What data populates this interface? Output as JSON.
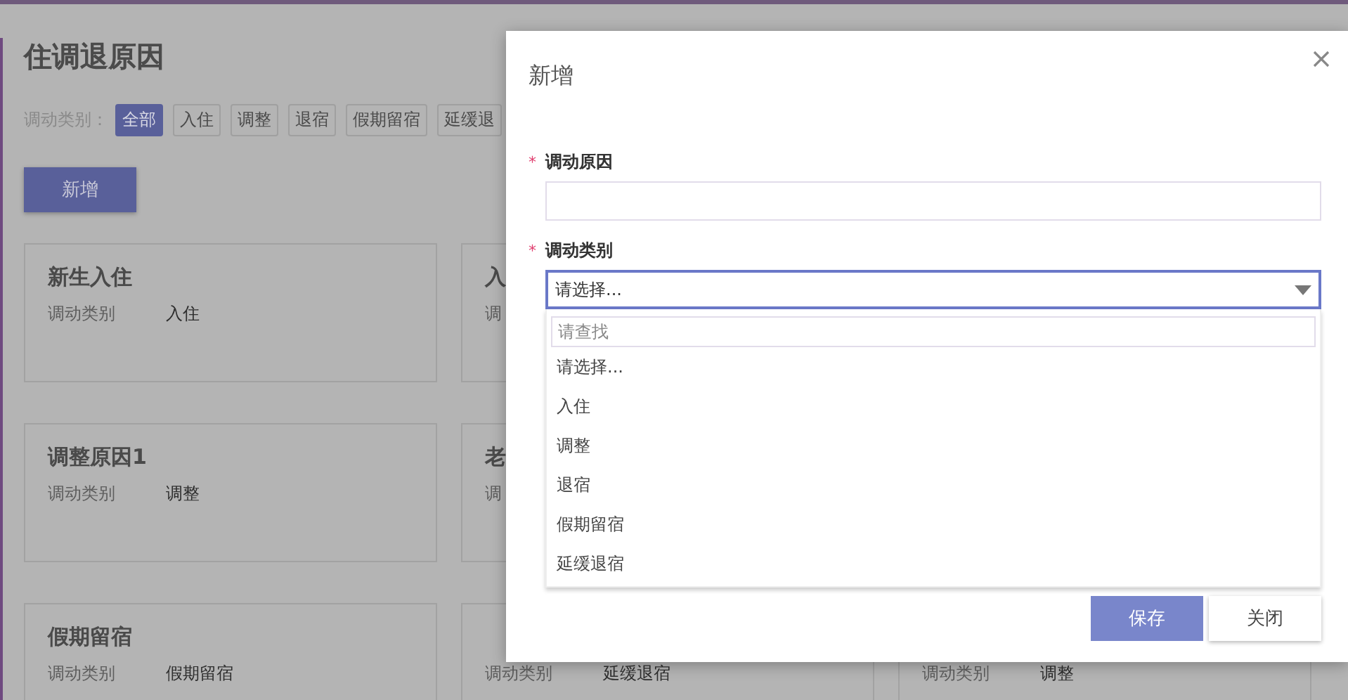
{
  "page": {
    "title": "住调退原因",
    "filter": {
      "label": "调动类别：",
      "chips": [
        {
          "label": "全部",
          "selected": true
        },
        {
          "label": "入住",
          "selected": false
        },
        {
          "label": "调整",
          "selected": false
        },
        {
          "label": "退宿",
          "selected": false
        },
        {
          "label": "假期留宿",
          "selected": false
        },
        {
          "label": "延缓退",
          "selected": false
        }
      ]
    },
    "add_button": "新增",
    "card_rows": [
      [
        {
          "title": "新生入住",
          "label": "调动类别",
          "value": "入住"
        },
        {
          "title": "入",
          "label": "调"
        }
      ],
      [
        {
          "title": "调整原因1",
          "label": "调动类别",
          "value": "调整"
        },
        {
          "title": "老",
          "label": "调"
        }
      ],
      [
        {
          "title": "假期留宿",
          "label": "调动类别",
          "value": "假期留宿"
        },
        {
          "label": "调动类别",
          "value": "延缓退宿"
        },
        {
          "label": "调动类别",
          "value": "调整"
        }
      ]
    ]
  },
  "dialog": {
    "title": "新增",
    "fields": [
      {
        "kind": "text",
        "marker": "*",
        "label": "调动原因"
      },
      {
        "kind": "select",
        "marker": "*",
        "label": "调动类别",
        "value": "请选择...",
        "expanded": true,
        "search_placeholder": "请查找",
        "options": [
          "请选择...",
          "入住",
          "调整",
          "退宿",
          "假期留宿",
          "延缓退宿"
        ]
      }
    ],
    "buttons": [
      {
        "kind": "primary",
        "label": "保存"
      },
      {
        "kind": "plain",
        "label": "关闭"
      }
    ]
  }
}
